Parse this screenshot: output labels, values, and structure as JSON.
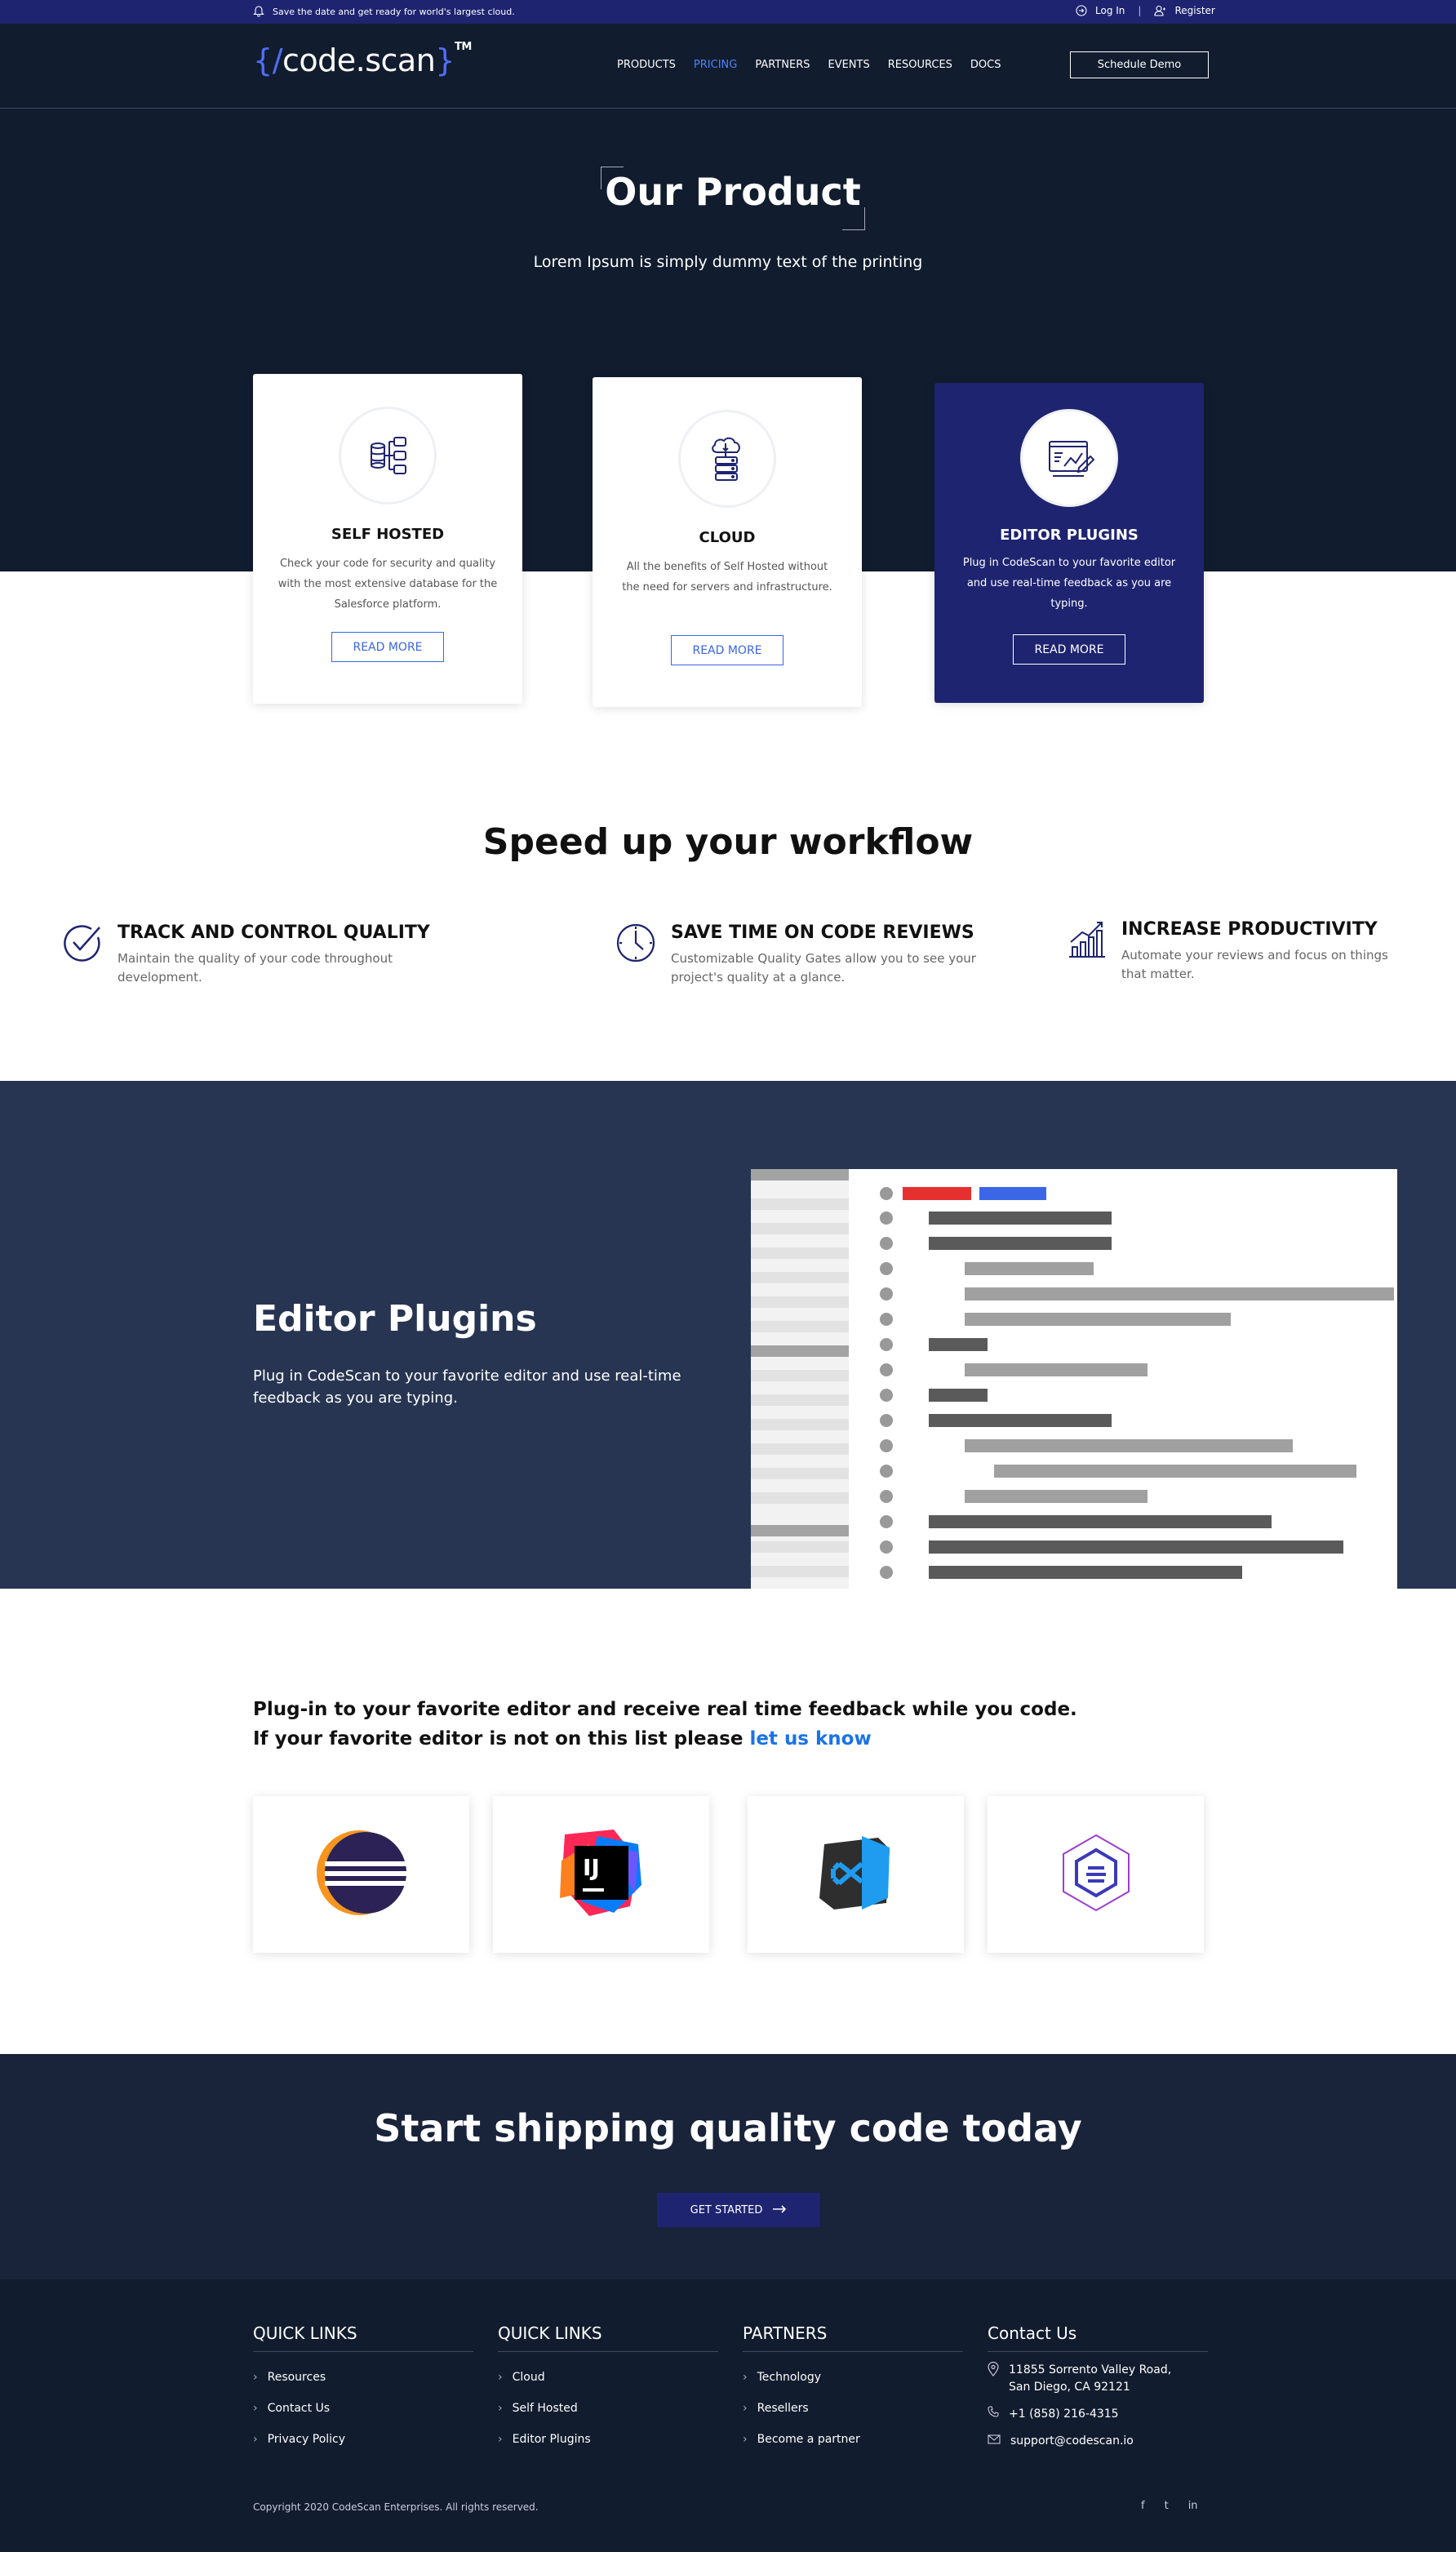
{
  "topbar": {
    "announcement": "Save the date and get ready for world's largest cloud.",
    "login": "Log In",
    "separator": "|",
    "register": "Register"
  },
  "header": {
    "logo_open": "{",
    "logo_slash": "/",
    "logo_name": "code.scan",
    "logo_close": "}",
    "logo_tm": "TM",
    "nav": [
      "PRODUCTS",
      "PRICING",
      "PARTNERS",
      "EVENTS",
      "RESOURCES",
      "DOCS"
    ],
    "nav_active": "PRICING",
    "demo_button": "Schedule Demo"
  },
  "hero": {
    "title": "Our Product",
    "subtitle": "Lorem Ipsum is simply dummy text of the printing"
  },
  "products": [
    {
      "icon": "server-hierarchy-icon",
      "title": "SELF HOSTED",
      "desc": "Check your code for security and quality with the most extensive database for the Salesforce platform.",
      "button": "READ MORE"
    },
    {
      "icon": "cloud-server-icon",
      "title": "CLOUD",
      "desc": "All the benefits of Self Hosted without the need for servers and infrastructure.",
      "button": "READ MORE"
    },
    {
      "icon": "editor-chart-icon",
      "title": "EDITOR PLUGINS",
      "desc": "Plug in CodeScan to your favorite editor and use real-time feedback as you are typing.",
      "button": "READ MORE"
    }
  ],
  "workflow": {
    "title": "Speed up your workflow",
    "items": [
      {
        "icon": "check-circle-icon",
        "title": "TRACK AND CONTROL QUALITY",
        "desc": "Maintain the quality of your code throughout development."
      },
      {
        "icon": "clock-icon",
        "title": "SAVE TIME ON CODE REVIEWS",
        "desc": "Customizable Quality Gates allow you to see your project's quality at a glance."
      },
      {
        "icon": "growth-chart-icon",
        "title": "INCREASE PRODUCTIVITY",
        "desc": "Automate your reviews and focus on things that matter."
      }
    ]
  },
  "editor_plugins": {
    "title": "Editor Plugins",
    "desc": "Plug in CodeScan to your favorite editor and use real-time feedback as you are typing."
  },
  "plugin_list": {
    "line1": "Plug-in to your favorite editor and receive real time feedback while you code.",
    "line2": "If your favorite editor is not on this list please",
    "link": "let us know",
    "editors": [
      "eclipse-logo-icon",
      "intellij-logo-icon",
      "vscode-logo-icon",
      "codescan-hexagon-logo-icon"
    ]
  },
  "cta": {
    "title": "Start shipping quality code today",
    "button": "GET STARTED"
  },
  "footer": {
    "columns": [
      {
        "heading": "QUICK LINKS",
        "links": [
          "Resources",
          "Contact Us",
          "Privacy Policy"
        ]
      },
      {
        "heading": "QUICK LINKS",
        "links": [
          "Cloud",
          "Self Hosted",
          "Editor Plugins"
        ]
      },
      {
        "heading": "PARTNERS",
        "links": [
          "Technology",
          "Resellers",
          "Become a partner"
        ]
      }
    ],
    "contact": {
      "heading": "Contact Us",
      "address_line1": "11855 Sorrento Valley Road,",
      "address_line2": "San Diego, CA 92121",
      "phone": "+1 (858) 216-4315",
      "email": "support@codescan.io"
    },
    "copyright": "Copyright 2020 CodeScan Enterprises. All rights reserved.",
    "socials": [
      "f",
      "t",
      "in"
    ]
  },
  "colors": {
    "topbar": "#1e2470",
    "hero_bg": "#111c2e",
    "accent_blue": "#3a66e0",
    "plugins_band": "#273552",
    "link_blue": "#1a73e8"
  }
}
